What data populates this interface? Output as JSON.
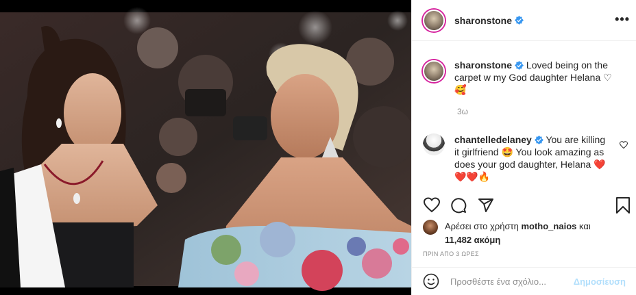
{
  "post": {
    "image_alt": "photo",
    "author": "sharonstone"
  },
  "header": {
    "username": "sharonstone",
    "more_label": "•••"
  },
  "caption": {
    "username": "sharonstone",
    "text": "Loved being on the carpet w my God daughter Helana ♡",
    "emoji": "🥰",
    "time": "3ω"
  },
  "comments": [
    {
      "username": "chantelledelaney",
      "text": "You are killing it girlfriend 🤩 You look amazing as does your god daughter, Helana ❤️❤️❤️🔥"
    }
  ],
  "likes": {
    "prefix": "Αρέσει στο χρήστη",
    "user": "motho_naios",
    "conj": "και",
    "count": "11,482 ακόμη"
  },
  "posted_ago": "ΠΡΙΝ ΑΠΟ 3 ΩΡΕΣ",
  "add_comment": {
    "placeholder": "Προσθέστε ένα σχόλιο...",
    "post_label": "Δημοσίευση"
  },
  "colors": {
    "verified": "#3897f0",
    "post_disabled": "#b2dffc"
  },
  "icons": [
    "verified-icon",
    "more-icon",
    "heart-icon",
    "comment-icon",
    "share-icon",
    "bookmark-icon",
    "emoji-icon"
  ]
}
